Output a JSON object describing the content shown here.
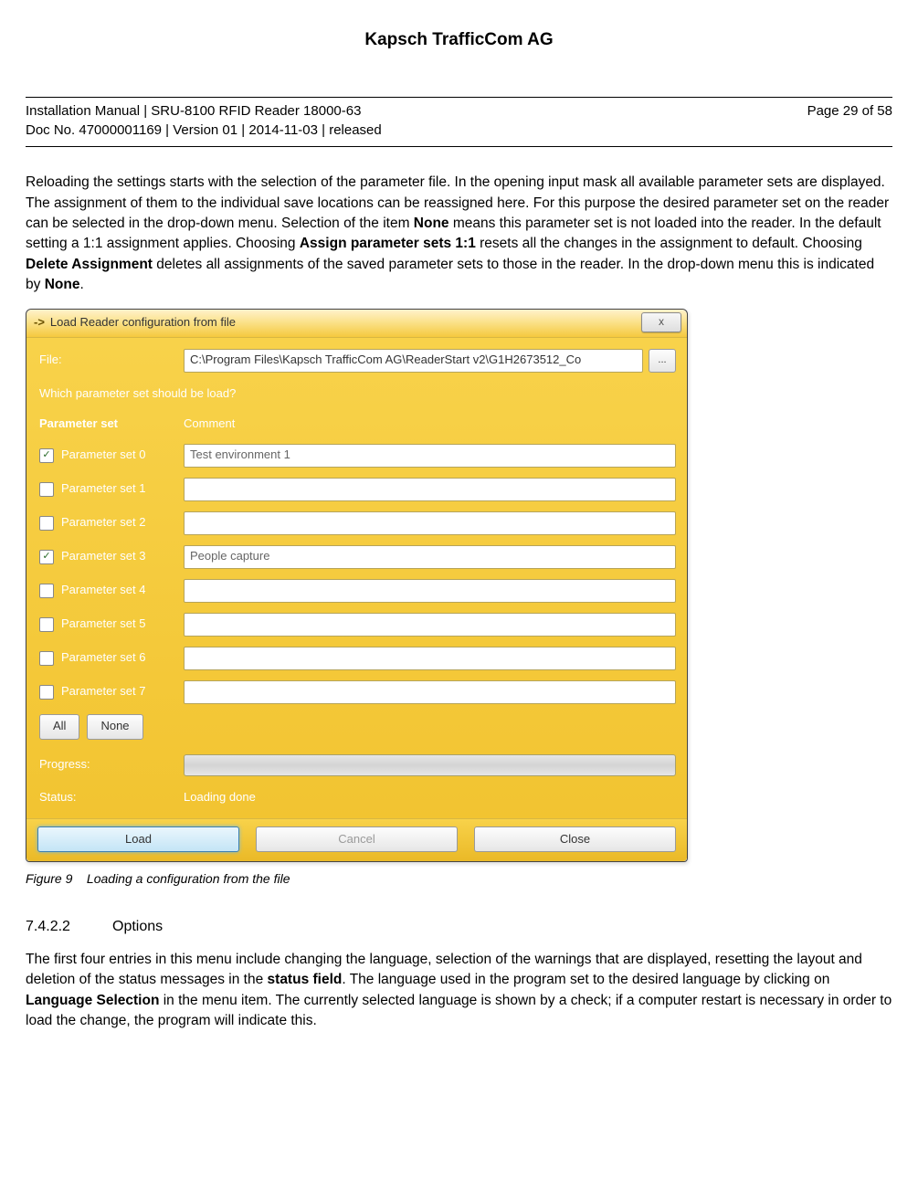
{
  "company": "Kapsch TrafficCom AG",
  "header": {
    "line1": "Installation Manual | SRU-8100 RFID Reader 18000-63",
    "line2": "Doc No. 47000001169 | Version 01 | 2014-11-03 | released",
    "page": "Page 29 of 58"
  },
  "paragraph1": {
    "t1": "Reloading the settings starts with the selection of the parameter file. In the opening input mask all available parameter sets are displayed. The assignment of them to the individual save locations can be reassigned here. For this purpose the desired parameter set on the reader can be selected in the drop-down menu. Selection of the item ",
    "b1": "None",
    "t2": " means this parameter set is not loaded into the reader. In the default setting a 1:1 assignment applies. Choosing ",
    "b2": "Assign parameter sets 1:1",
    "t3": " resets all the changes in the assignment to default. Choosing ",
    "b3": "Delete Assignment",
    "t4": " deletes all assignments of the saved parameter sets to those in the reader. In the drop-down menu this is indicated by ",
    "b4": "None",
    "t5": "."
  },
  "dialog": {
    "title_prefix": "->",
    "title": "Load Reader configuration from file",
    "close_x": "x",
    "file_label": "File:",
    "file_value": "C:\\Program Files\\Kapsch TrafficCom AG\\ReaderStart v2\\G1H2673512_Co",
    "browse": "...",
    "question": "Which parameter set should be load?",
    "col_param": "Parameter set",
    "col_comment": "Comment",
    "rows": [
      {
        "checked": true,
        "label": "Parameter set 0",
        "comment": "Test environment 1"
      },
      {
        "checked": false,
        "label": "Parameter set 1",
        "comment": ""
      },
      {
        "checked": false,
        "label": "Parameter set 2",
        "comment": ""
      },
      {
        "checked": true,
        "label": "Parameter set 3",
        "comment": "People capture"
      },
      {
        "checked": false,
        "label": "Parameter set 4",
        "comment": ""
      },
      {
        "checked": false,
        "label": "Parameter set 5",
        "comment": ""
      },
      {
        "checked": false,
        "label": "Parameter set 6",
        "comment": ""
      },
      {
        "checked": false,
        "label": "Parameter set 7",
        "comment": ""
      }
    ],
    "btn_all": "All",
    "btn_none": "None",
    "progress_label": "Progress:",
    "status_label": "Status:",
    "status_value": "Loading done",
    "btn_load": "Load",
    "btn_cancel": "Cancel",
    "btn_close": "Close"
  },
  "figure_caption_num": "Figure 9",
  "figure_caption_text": "Loading a configuration from the file",
  "section": {
    "num": "7.4.2.2",
    "title": "Options"
  },
  "paragraph2": {
    "t1": "The first four entries in this menu include changing the language, selection of the warnings that are displayed, resetting the layout and deletion of the status messages in the ",
    "b1": "status field",
    "t2": ". The language used in the program set to the desired language by clicking on ",
    "b2": "Language Selection",
    "t3": " in the menu item. The currently selected language is shown by a check; if a computer restart is necessary in order to load the change, the program will indicate this."
  }
}
